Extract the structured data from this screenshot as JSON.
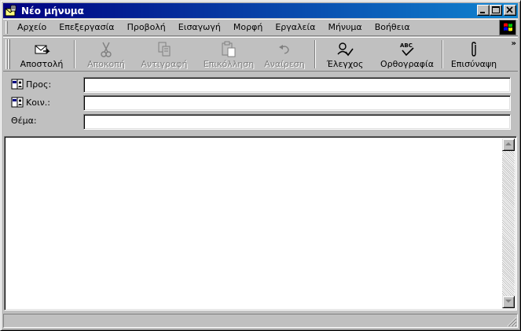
{
  "window": {
    "title": "Νέο μήνυμα",
    "icon": "envelope-new-icon"
  },
  "menubar": {
    "items": [
      "Αρχείο",
      "Επεξεργασία",
      "Προβολή",
      "Εισαγωγή",
      "Μορφή",
      "Εργαλεία",
      "Μήνυμα",
      "Βοήθεια"
    ],
    "logo": "windows-logo-icon"
  },
  "toolbar": {
    "send": {
      "label": "Αποστολή",
      "icon": "send-icon",
      "enabled": true
    },
    "cut": {
      "label": "Αποκοπή",
      "icon": "scissors-icon",
      "enabled": false
    },
    "copy": {
      "label": "Αντιγραφή",
      "icon": "copy-icon",
      "enabled": false
    },
    "paste": {
      "label": "Επικόλληση",
      "icon": "paste-icon",
      "enabled": false
    },
    "undo": {
      "label": "Αναίρεση",
      "icon": "undo-icon",
      "enabled": false
    },
    "check": {
      "label": "Έλεγχος",
      "icon": "check-names-icon",
      "enabled": true
    },
    "spelling": {
      "label": "Ορθογραφία",
      "icon": "spelling-icon",
      "enabled": true
    },
    "attach": {
      "label": "Επισύναψη",
      "icon": "paperclip-icon",
      "enabled": true
    },
    "more": "»"
  },
  "fields": {
    "to": {
      "label": "Προς:",
      "value": ""
    },
    "cc": {
      "label": "Κοιν.:",
      "value": ""
    },
    "subject": {
      "label": "Θέμα:",
      "value": ""
    }
  },
  "body": {
    "value": ""
  },
  "status": {
    "text": ""
  },
  "colors": {
    "titlebar_start": "#000080",
    "titlebar_end": "#1084d0",
    "face": "#c0c0c0"
  }
}
